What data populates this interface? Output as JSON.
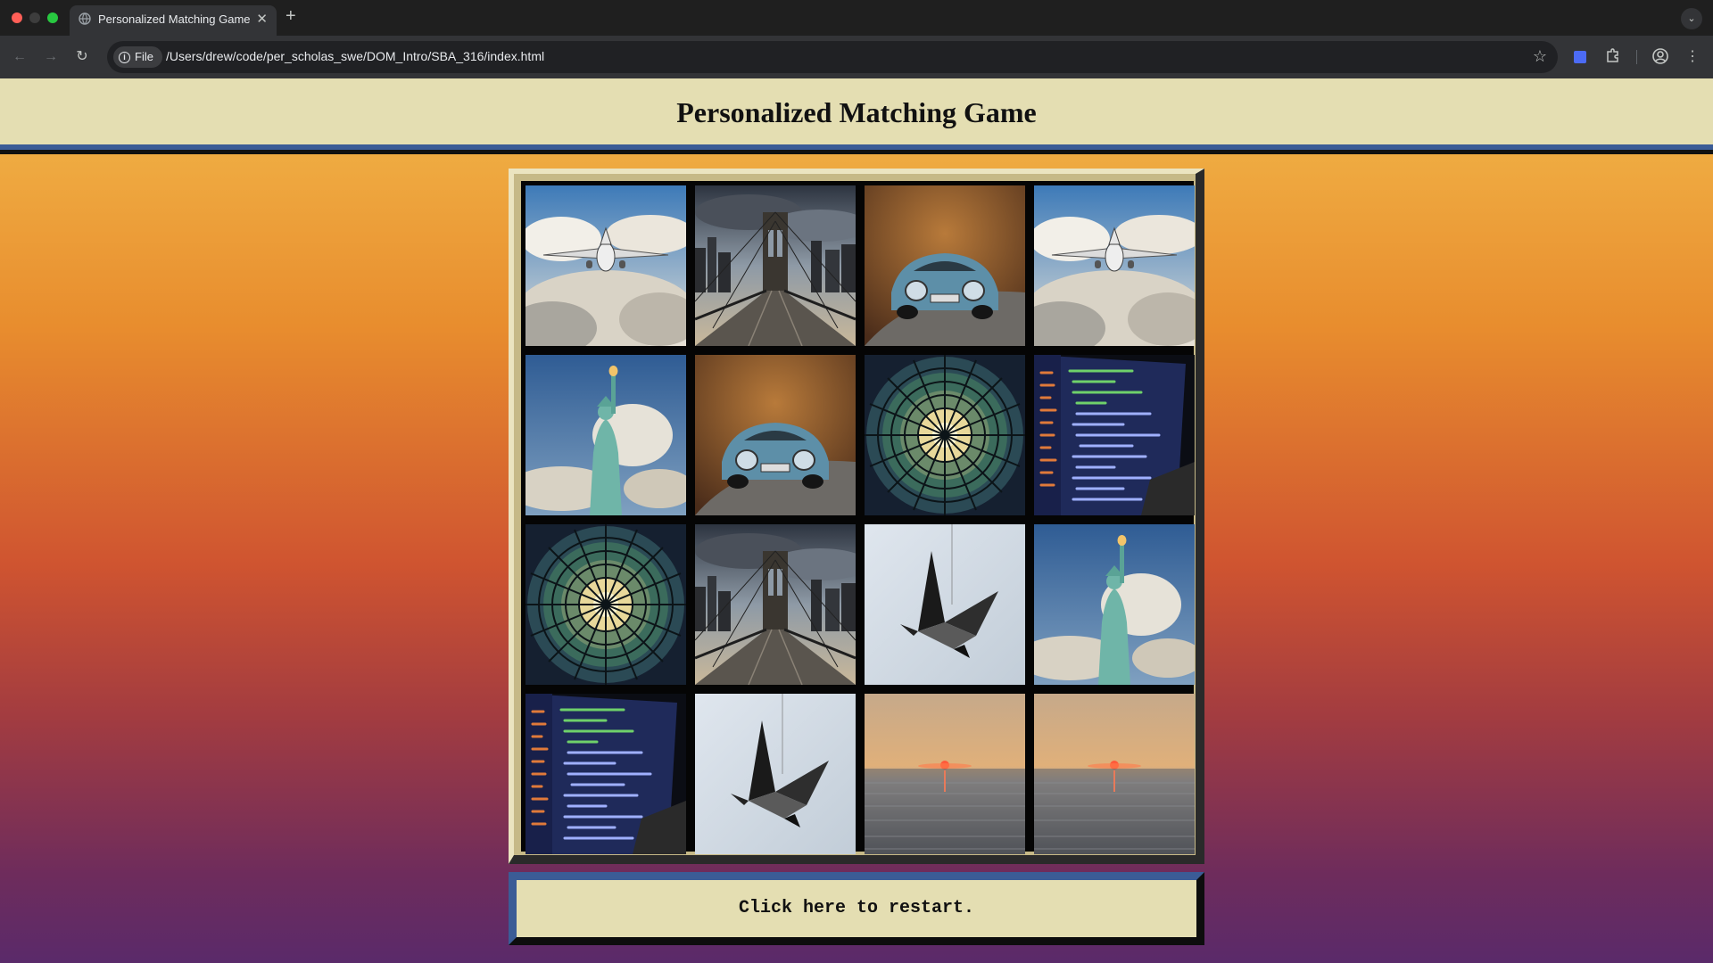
{
  "browser": {
    "tab_title": "Personalized Matching Game",
    "omnibox_chip": "File",
    "url": "/Users/drew/code/per_scholas_swe/DOM_Intro/SBA_316/index.html"
  },
  "game": {
    "title": "Personalized Matching Game",
    "restart_label": "Click here to restart.",
    "cards": [
      "airplane",
      "brooklyn-bridge",
      "blue-car",
      "airplane",
      "statue-of-liberty",
      "blue-car",
      "stained-glass-dome",
      "code-screen",
      "stained-glass-dome",
      "brooklyn-bridge",
      "paper-crane",
      "statue-of-liberty",
      "code-screen",
      "paper-crane",
      "ocean-sunset",
      "ocean-sunset"
    ]
  }
}
